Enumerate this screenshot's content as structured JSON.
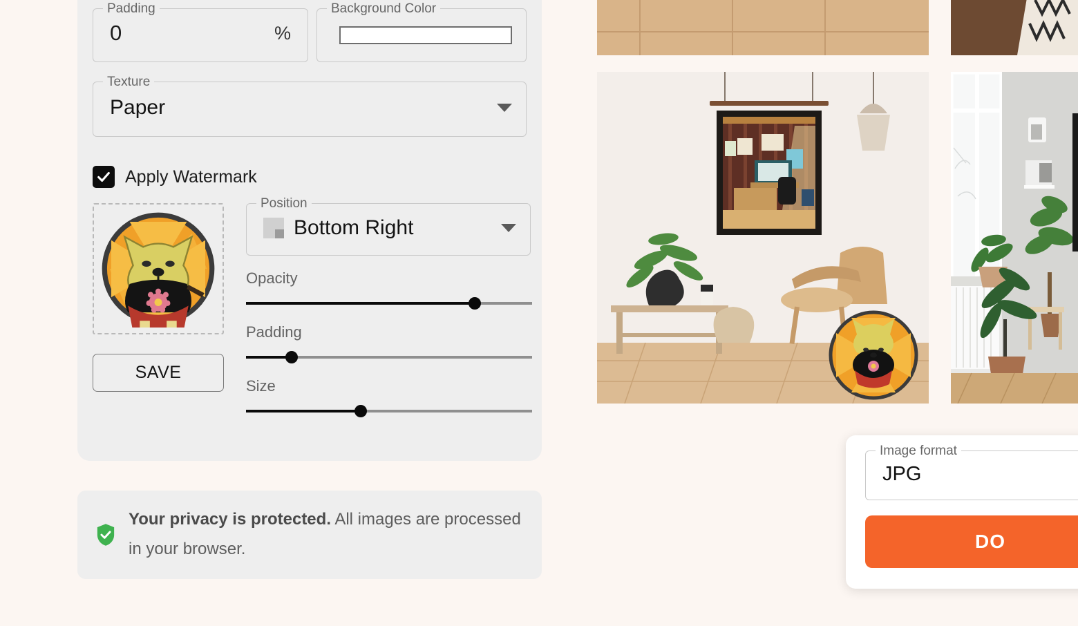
{
  "settings": {
    "padding": {
      "legend": "Padding",
      "value": "0",
      "unit": "%"
    },
    "background_color": {
      "legend": "Background Color",
      "value": "#FFFFFF"
    },
    "texture": {
      "legend": "Texture",
      "value": "Paper"
    },
    "watermark": {
      "toggle_label": "Apply Watermark",
      "checked": true,
      "logo_icon": "shiba-samurai-logo",
      "save_label": "SAVE",
      "position": {
        "legend": "Position",
        "value": "Bottom Right",
        "icon": "position-bottom-right-icon"
      },
      "sliders": [
        {
          "label": "Opacity",
          "percent": 80
        },
        {
          "label": "Padding",
          "percent": 16
        },
        {
          "label": "Size",
          "percent": 40
        }
      ]
    }
  },
  "privacy": {
    "icon": "shield-check-icon",
    "strong": "Your privacy is protected.",
    "rest": " All images are processed in your browser."
  },
  "download": {
    "format": {
      "legend": "Image format",
      "value": "JPG"
    },
    "button_label": "DO",
    "button_color": "#F4642A"
  },
  "previews": {
    "column_a": [
      {
        "name": "mockup-wood-floor-top",
        "kind": "floor"
      },
      {
        "name": "mockup-living-room-poster",
        "kind": "living-room"
      }
    ],
    "column_b": [
      {
        "name": "mockup-rug-floor-top",
        "kind": "rug"
      },
      {
        "name": "mockup-window-plants",
        "kind": "window"
      }
    ]
  }
}
